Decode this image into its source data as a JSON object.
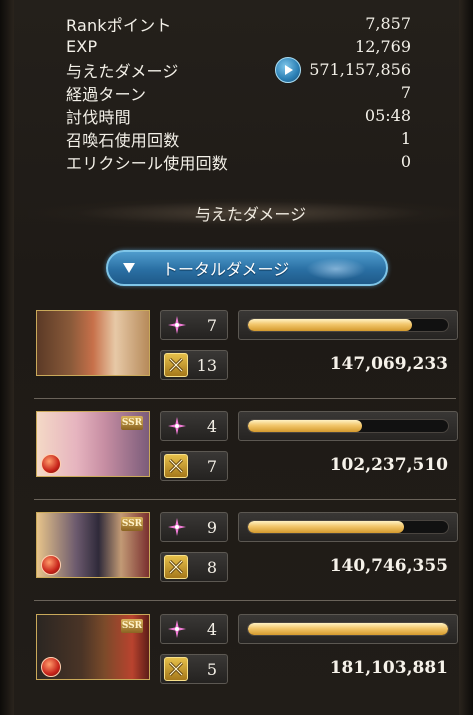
{
  "stats": [
    {
      "label": "Rankポイント",
      "value": "7,857"
    },
    {
      "label": "EXP",
      "value": "12,769"
    },
    {
      "label": "与えたダメージ",
      "value": "571,157,856",
      "icon": "play-icon"
    },
    {
      "label": "経過ターン",
      "value": "7"
    },
    {
      "label": "討伐時間",
      "value": "05:48"
    },
    {
      "label": "召喚石使用回数",
      "value": "1"
    },
    {
      "label": "エリクシール使用回数",
      "value": "0"
    }
  ],
  "section_title": "与えたダメージ",
  "dropdown": {
    "label": "トータルダメージ",
    "icon": "chevron-down-icon"
  },
  "colors": {
    "accent_blue": "#2a6fa3",
    "bar_gold": "#f2c66b",
    "fire_element": "#c7231a"
  },
  "characters": [
    {
      "portrait": "player-avatar-pair",
      "ssr": false,
      "element_icon": false,
      "skill_count": "7",
      "ougi_count": "13",
      "damage": "147,069,233",
      "bar_pct": 0.82
    },
    {
      "portrait": "ssr-character-1",
      "ssr": true,
      "ssr_label": "SSR",
      "element_icon": true,
      "skill_count": "4",
      "ougi_count": "7",
      "damage": "102,237,510",
      "bar_pct": 0.57
    },
    {
      "portrait": "ssr-character-2",
      "ssr": true,
      "ssr_label": "SSR",
      "element_icon": true,
      "skill_count": "9",
      "ougi_count": "8",
      "damage": "140,746,355",
      "bar_pct": 0.78
    },
    {
      "portrait": "ssr-character-3",
      "ssr": true,
      "ssr_label": "SSR",
      "element_icon": true,
      "skill_count": "4",
      "ougi_count": "5",
      "damage": "181,103,881",
      "bar_pct": 1.0
    }
  ]
}
